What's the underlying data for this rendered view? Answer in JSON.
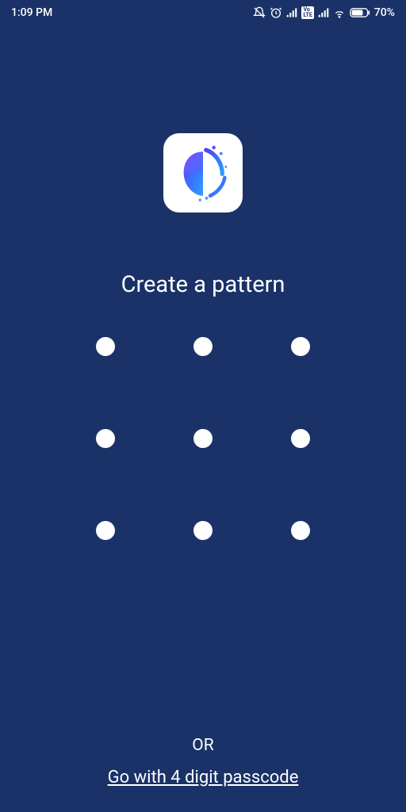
{
  "status": {
    "time": "1:09 PM",
    "battery": "70%",
    "volte": "VoLTE"
  },
  "title": "Create a pattern",
  "or": "OR",
  "passcode_link": "Go with 4 digit passcode"
}
